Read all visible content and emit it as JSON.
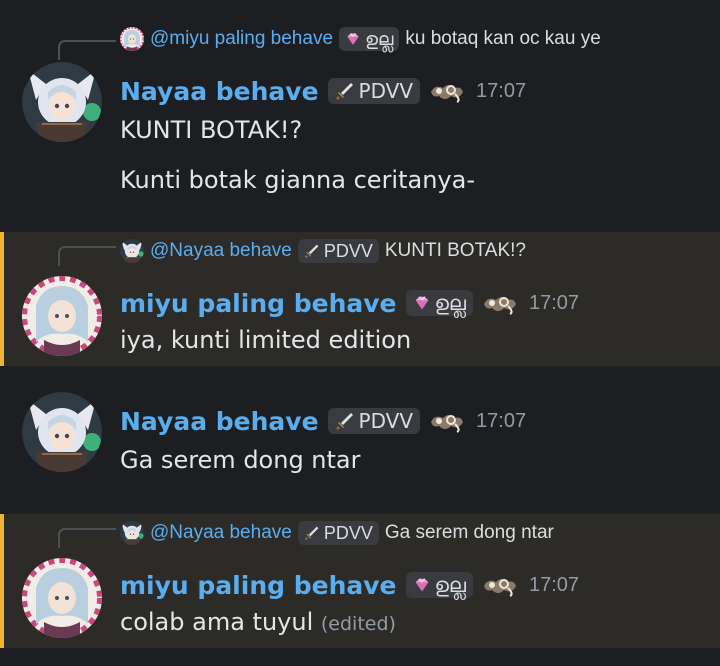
{
  "messages": [
    {
      "reply": {
        "name": "@miyu paling behave",
        "tag": "ഉല്ല",
        "text": "ku botaq kan oc kau ye"
      },
      "author": "Nayaa behave",
      "tag": "PDVV",
      "time": "17:07",
      "lines": [
        "KUNTI BOTAK!?",
        "Kunti botak gianna ceritanya-"
      ]
    },
    {
      "reply": {
        "name": "@Nayaa behave",
        "tag": "PDVV",
        "text": "KUNTI BOTAK!?"
      },
      "author": "miyu paling behave",
      "tag": "ഉല്ല",
      "time": "17:07",
      "lines": [
        "iya, kunti limited edition"
      ]
    },
    {
      "author": "Nayaa behave",
      "tag": "PDVV",
      "time": "17:07",
      "lines": [
        "Ga serem dong ntar"
      ]
    },
    {
      "reply": {
        "name": "@Nayaa behave",
        "tag": "PDVV",
        "text": "Ga serem dong ntar"
      },
      "author": "miyu paling behave",
      "tag": "ഉല്ല",
      "time": "17:07",
      "lines": [
        "colab ama tuyul"
      ],
      "edited": "(edited)"
    }
  ],
  "colors": {
    "username": "#5aaef0",
    "mention_bar": "#f0b232",
    "highlight_bg": "#2c2b27",
    "background": "#1d1e22"
  },
  "icons": [
    "sword-icon",
    "gem-icon",
    "guild-emblem-icon",
    "avatar-nayaa",
    "avatar-miyu"
  ]
}
